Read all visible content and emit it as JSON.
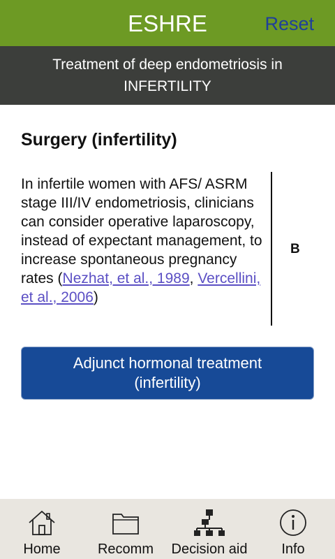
{
  "header": {
    "title": "ESHRE",
    "reset_label": "Reset"
  },
  "subheader": {
    "line1": "Treatment of deep endometriosis in",
    "line2": "INFERTILITY"
  },
  "section": {
    "title": "Surgery (infertility)"
  },
  "recommendation": {
    "text": "In infertile women with AFS/ ASRM stage III/IV endometriosis, clinicians can consider operative laparoscopy, instead of expectant management, to increase spontaneous pregnancy rates",
    "open_paren": "(",
    "ref1": "Nezhat, et al., 1989",
    "separator": ", ",
    "ref2": "Vercellini, et al., 2006",
    "close_paren": ")",
    "grade": "B"
  },
  "next_button": {
    "line1": "Adjunct hormonal treatment",
    "line2": "(infertility)"
  },
  "bottom_nav": {
    "items": [
      {
        "label": "Home",
        "icon": "home-icon"
      },
      {
        "label": "Recomm",
        "icon": "folder-icon"
      },
      {
        "label": "Decision aid",
        "icon": "hierarchy-icon"
      },
      {
        "label": "Info",
        "icon": "info-icon"
      }
    ]
  },
  "colors": {
    "top_bar": "#6d9a24",
    "subheader": "#3c3e3b",
    "button": "#174a97",
    "link": "#5b4fc4",
    "reset": "#1f3f9a"
  }
}
